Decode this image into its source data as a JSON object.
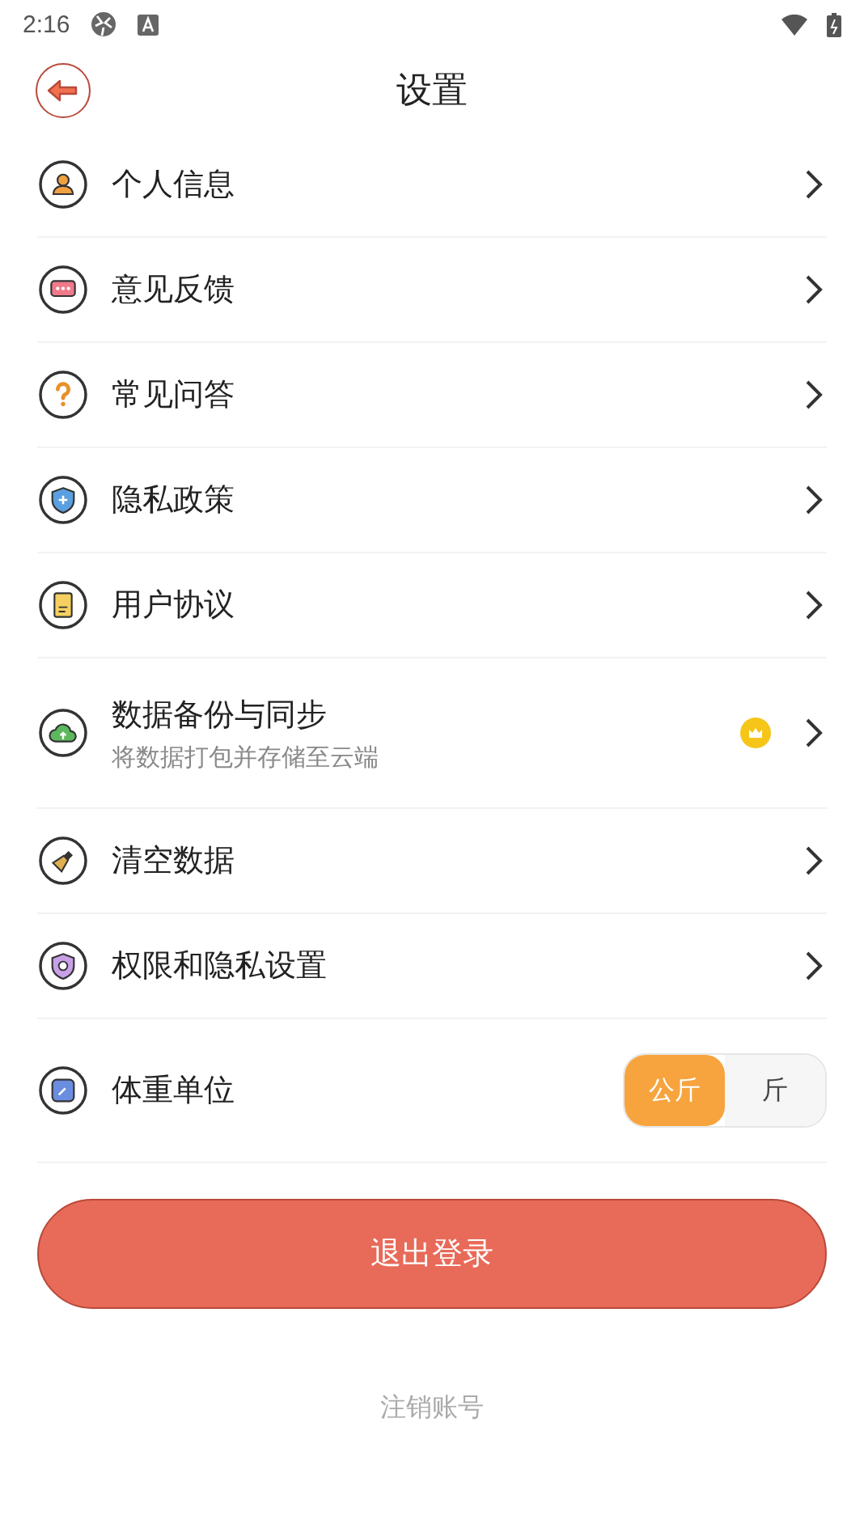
{
  "status_bar": {
    "time": "2:16"
  },
  "header": {
    "title": "设置"
  },
  "items": [
    {
      "kind": "link",
      "label": "个人信息",
      "premium": false
    },
    {
      "kind": "link",
      "label": "意见反馈",
      "premium": false
    },
    {
      "kind": "link",
      "label": "常见问答",
      "premium": false
    },
    {
      "kind": "link",
      "label": "隐私政策",
      "premium": false
    },
    {
      "kind": "link",
      "label": "用户协议",
      "premium": false
    },
    {
      "kind": "link",
      "label": "数据备份与同步",
      "subtitle": "将数据打包并存储至云端",
      "premium": true
    },
    {
      "kind": "link",
      "label": "清空数据",
      "premium": false
    },
    {
      "kind": "link",
      "label": "权限和隐私设置",
      "premium": false
    },
    {
      "kind": "segmented",
      "label": "体重单位",
      "options": [
        {
          "label": "公斤",
          "selected": true
        },
        {
          "label": "斤",
          "selected": false
        }
      ]
    }
  ],
  "logout_button": "退出登录",
  "delete_account": "注销账号"
}
